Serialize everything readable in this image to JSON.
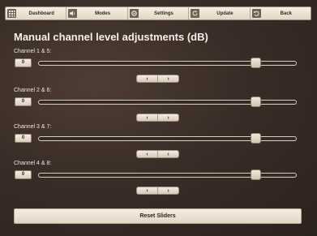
{
  "nav": [
    {
      "label": "Dashboard",
      "icon": "grid-icon"
    },
    {
      "label": "Modes",
      "icon": "speaker-icon"
    },
    {
      "label": "Settings",
      "icon": "gear-icon"
    },
    {
      "label": "Update",
      "icon": "refresh-icon"
    },
    {
      "label": "Back",
      "icon": "back-arrow-icon"
    }
  ],
  "title": "Manual channel level adjustments (dB)",
  "channels": [
    {
      "label": "Channel 1 & 5:",
      "value": "0",
      "level_percent": 84.3
    },
    {
      "label": "Channel 2 & 6:",
      "value": "0",
      "level_percent": 84.3
    },
    {
      "label": "Channel 3 & 7:",
      "value": "0",
      "level_percent": 84.3
    },
    {
      "label": "Channel 4 & 8:",
      "value": "0",
      "level_percent": 84.3
    }
  ],
  "stepper": {
    "decrement": "‹",
    "increment": "›"
  },
  "reset_label": "Reset Sliders",
  "colors": {
    "background": "#3a2d27",
    "button_face": "#efe6d8",
    "icon_tile": "#6d6356",
    "text_light": "#f5f0ea"
  }
}
